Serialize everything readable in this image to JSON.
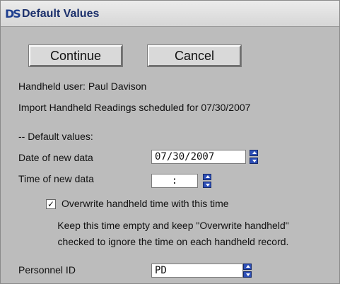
{
  "window": {
    "title": "Default Values",
    "icon_name": "app-logo-icon",
    "icon_text": "DS"
  },
  "buttons": {
    "continue_label": "Continue",
    "cancel_label": "Cancel"
  },
  "info": {
    "handheld_user": "Handheld user: Paul Davison",
    "import_schedule": "Import Handheld Readings scheduled for 07/30/2007"
  },
  "defaults": {
    "section_label": "-- Default values:",
    "date_label": "Date of new data",
    "date_value": "07/30/2007",
    "time_label": "Time of new data",
    "time_value": ":",
    "overwrite_checked": true,
    "overwrite_label": "Overwrite handheld time with this time",
    "note_line1": "Keep this time empty and keep \"Overwrite handheld\"",
    "note_line2": "checked to ignore the time on each handheld record.",
    "personnel_label": "Personnel ID",
    "personnel_value": "PD"
  },
  "colors": {
    "window_bg": "#bcbcbc",
    "title_text": "#1b2f6b",
    "spinner": "#2d4fb7"
  }
}
